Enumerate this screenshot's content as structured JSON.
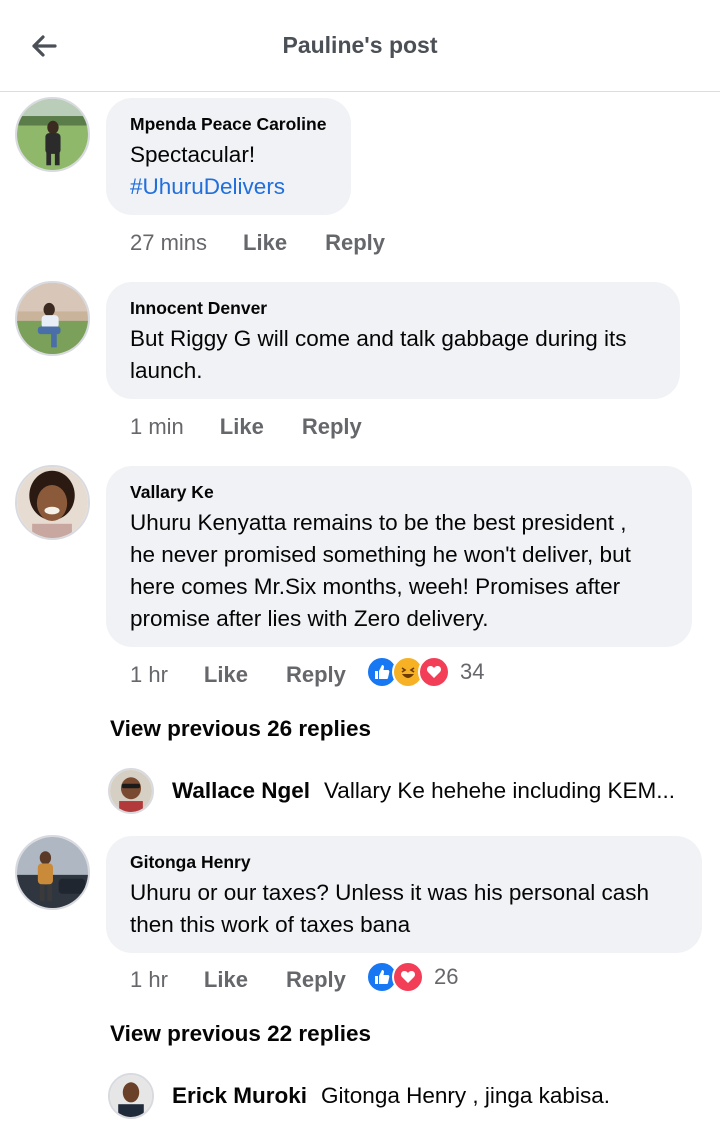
{
  "header": {
    "title": "Pauline's post"
  },
  "comments": [
    {
      "author": "Mpenda Peace Caroline",
      "text": "Spectacular!",
      "hashtag": "#UhuruDelivers",
      "time": "27 mins",
      "like": "Like",
      "reply": "Reply"
    },
    {
      "author": "Innocent Denver",
      "text_lines": [
        "But Riggy G will come and talk gabbage during its",
        "launch."
      ],
      "time": "1 min",
      "like": "Like",
      "reply": "Reply"
    },
    {
      "author": "Vallary Ke",
      "text_lines": [
        "Uhuru Kenyatta remains to be the best president ,",
        "he never promised something he won't deliver, but",
        "here comes Mr.Six months, weeh! Promises after",
        "promise after lies with Zero delivery."
      ],
      "time": "1 hr",
      "like": "Like",
      "reply": "Reply",
      "reaction_icons": [
        "like-icon",
        "haha-icon",
        "love-icon"
      ],
      "reaction_count": "34",
      "view_previous": "View previous 26 replies",
      "reply_preview": {
        "name": "Wallace Ngel",
        "text": "Vallary Ke hehehe including KEM..."
      }
    },
    {
      "author": "Gitonga Henry",
      "text_lines": [
        "Uhuru or our taxes? Unless it was his personal cash",
        "then this work of taxes bana"
      ],
      "time": "1 hr",
      "like": "Like",
      "reply": "Reply",
      "reaction_icons": [
        "like-icon",
        "love-icon"
      ],
      "reaction_count": "26",
      "view_previous": "View previous 22 replies",
      "reply_preview": {
        "name": "Erick Muroki",
        "text": "Gitonga Henry , jinga kabisa."
      }
    }
  ],
  "colors": {
    "like": "#1877f2",
    "love": "#f33e58",
    "haha": "#f7b125",
    "hashtag": "#216fdb",
    "bubble": "#f0f2f5",
    "meta": "#65676b"
  }
}
